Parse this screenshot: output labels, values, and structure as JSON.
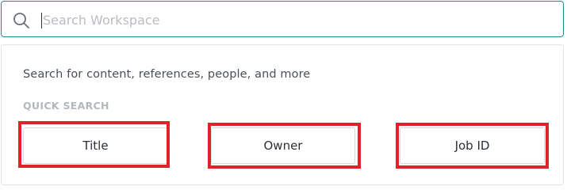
{
  "search": {
    "placeholder": "Search Workspace",
    "value": ""
  },
  "dropdown": {
    "hint": "Search for content, references, people, and more",
    "quick_search_title": "QUICK SEARCH",
    "quick_search_options": [
      {
        "label": "Title"
      },
      {
        "label": "Owner"
      },
      {
        "label": "Job ID"
      }
    ]
  },
  "colors": {
    "accent_border": "#1f8a93",
    "highlight": "#e0222a",
    "muted_text": "#b4b8be"
  },
  "icons": {
    "search": "search-icon"
  }
}
